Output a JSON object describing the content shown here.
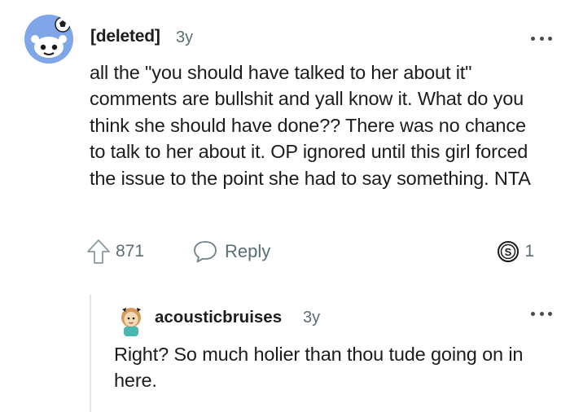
{
  "comment": {
    "username": "[deleted]",
    "age": "3y",
    "avatar": "snoo-avatar-icon",
    "body": "all the \"you should have talked to her about it\" comments are bullshit and yall know it. What do you think she should have done?? There was no chance to talk to her about it. OP ignored until this girl forced the issue to the point she had to say something. NTA",
    "score": "871",
    "reply_label": "Reply",
    "award_count": "1"
  },
  "reply": {
    "username": "acousticbruises",
    "age": "3y",
    "avatar": "custom-avatar-icon",
    "body": "Right? So much holier than thou tude going on in here."
  },
  "colors": {
    "text": "#1c1c1c",
    "meta": "#576f76",
    "avatar_bg": "#7fa6e8",
    "thread_line": "#e5e5e5"
  }
}
